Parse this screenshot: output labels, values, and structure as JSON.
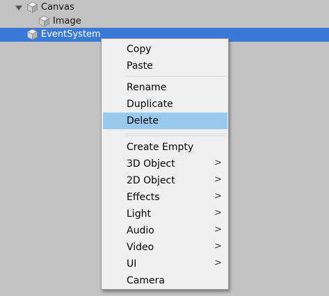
{
  "hierarchy": {
    "items": [
      {
        "label": "Canvas",
        "icon": "gameobject-cube-icon",
        "expanded": true
      },
      {
        "label": "Image",
        "icon": "gameobject-cube-icon"
      },
      {
        "label": "EventSystem",
        "icon": "gameobject-cube-icon",
        "selected": true
      }
    ]
  },
  "context_menu": {
    "items": [
      {
        "label": "Copy"
      },
      {
        "label": "Paste"
      },
      {
        "label": "Rename"
      },
      {
        "label": "Duplicate"
      },
      {
        "label": "Delete",
        "highlighted": true
      },
      {
        "label": "Create Empty"
      },
      {
        "label": "3D Object",
        "submenu_glyph": ">"
      },
      {
        "label": "2D Object",
        "submenu_glyph": ">"
      },
      {
        "label": "Effects",
        "submenu_glyph": ">"
      },
      {
        "label": "Light",
        "submenu_glyph": ">"
      },
      {
        "label": "Audio",
        "submenu_glyph": ">"
      },
      {
        "label": "Video",
        "submenu_glyph": ">"
      },
      {
        "label": "UI",
        "submenu_glyph": ">"
      },
      {
        "label": "Camera"
      }
    ]
  },
  "colors": {
    "panel_background": "#c2c2c2",
    "selection": "#3a79d7",
    "menu_background": "#f0f0f0",
    "menu_highlight": "#99c9ef"
  }
}
